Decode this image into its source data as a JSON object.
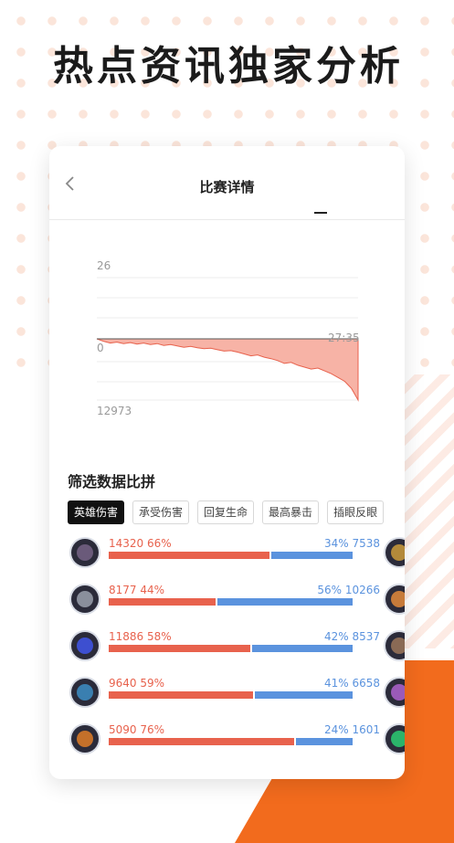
{
  "headline": "热点资讯独家分析",
  "nav": {
    "title": "比赛详情"
  },
  "chart_data": {
    "type": "area",
    "y_top_label": "26",
    "y_zero_label": "0",
    "y_bottom_label": "12973",
    "end_time_label": "27:35",
    "values": [
      0,
      -500,
      -900,
      -700,
      -1000,
      -800,
      -1100,
      -900,
      -1200,
      -1000,
      -1400,
      -1200,
      -1500,
      -1800,
      -1600,
      -1900,
      -2100,
      -2000,
      -2300,
      -2600,
      -2500,
      -2800,
      -3200,
      -3600,
      -3400,
      -3900,
      -4200,
      -4600,
      -5200,
      -5000,
      -5600,
      -6000,
      -6400,
      -6200,
      -6800,
      -7400,
      -8200,
      -9000,
      -10500,
      -12973
    ],
    "ylim": [
      -12973,
      26
    ]
  },
  "section": {
    "title": "筛选数据比拼"
  },
  "tabs": [
    "英雄伤害",
    "承受伤害",
    "回复生命",
    "最高暴击",
    "插眼反眼"
  ],
  "rows": [
    {
      "left": "14320 66%",
      "right": "34% 7538",
      "pct": 66,
      "lcolor": "#6a5a7a",
      "rcolor": "#b38a3a"
    },
    {
      "left": "8177 44%",
      "right": "56% 10266",
      "pct": 44,
      "lcolor": "#8a8f9c",
      "rcolor": "#c77b3a"
    },
    {
      "left": "11886 58%",
      "right": "42% 8537",
      "pct": 58,
      "lcolor": "#3d4fd0",
      "rcolor": "#8a6a55"
    },
    {
      "left": "9640 59%",
      "right": "41% 6658",
      "pct": 59,
      "lcolor": "#3a7fb0",
      "rcolor": "#9a5ab8"
    },
    {
      "left": "5090 76%",
      "right": "24% 1601",
      "pct": 76,
      "lcolor": "#c4702a",
      "rcolor": "#2bb36a"
    }
  ],
  "colors": {
    "accent": "#f26b1d",
    "red": "#e8624d",
    "blue": "#5b93de"
  }
}
